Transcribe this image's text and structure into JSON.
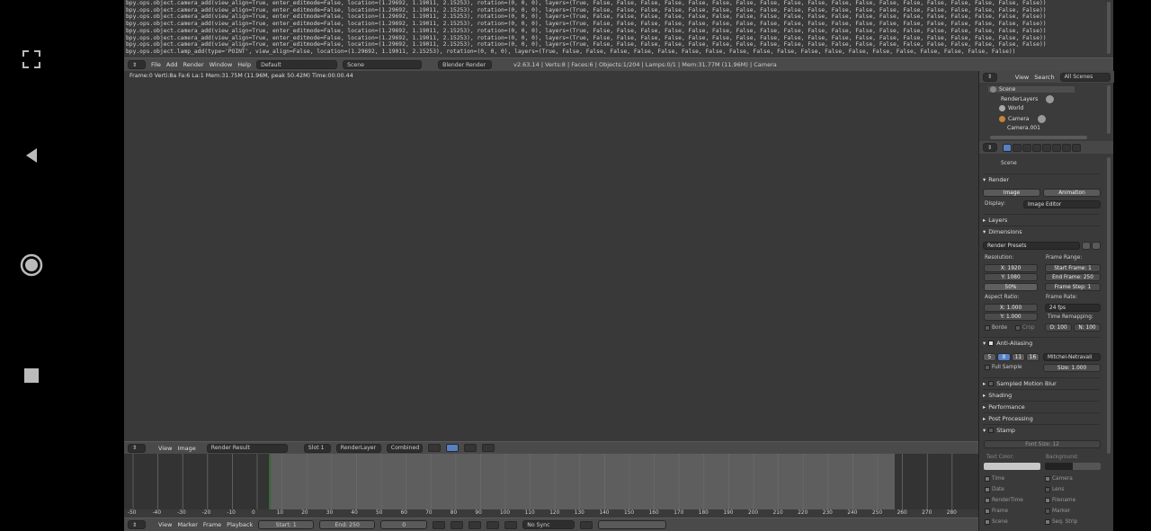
{
  "nav": {
    "expand_icon": "expand-icon",
    "back_icon": "back-icon",
    "home_icon": "home-icon",
    "recents_icon": "recents-icon"
  },
  "log_lines": [
    "bpy.ops.object.camera_add(view_align=True, enter_editmode=False, location=(1.29692, 1.19011, 2.15253), rotation=(0, 0, 0), layers=(True, False, False, False, False, False, False, False, False, False, False, False, False, False, False, False, False, False, False, False))",
    "bpy.ops.object.camera_add(view_align=True, enter_editmode=False, location=(1.29692, 1.19011, 2.15253), rotation=(0, 0, 0), layers=(True, False, False, False, False, False, False, False, False, False, False, False, False, False, False, False, False, False, False, False))",
    "bpy.ops.object.camera_add(view_align=True, enter_editmode=False, location=(1.29692, 1.19011, 2.15253), rotation=(0, 0, 0), layers=(True, False, False, False, False, False, False, False, False, False, False, False, False, False, False, False, False, False, False, False))",
    "bpy.ops.object.camera_add(view_align=True, enter_editmode=False, location=(1.29692, 1.19011, 2.15253), rotation=(0, 0, 0), layers=(True, False, False, False, False, False, False, False, False, False, False, False, False, False, False, False, False, False, False, False))",
    "bpy.ops.object.camera_add(view_align=True, enter_editmode=False, location=(1.29692, 1.19011, 2.15253), rotation=(0, 0, 0), layers=(True, False, False, False, False, False, False, False, False, False, False, False, False, False, False, False, False, False, False, False))",
    "bpy.ops.object.camera_add(view_align=True, enter_editmode=False, location=(1.29692, 1.19011, 2.15253), rotation=(0, 0, 0), layers=(True, False, False, False, False, False, False, False, False, False, False, False, False, False, False, False, False, False, False, False))",
    "bpy.ops.object.camera_add(view_align=True, enter_editmode=False, location=(1.29692, 1.19011, 2.15253), rotation=(0, 0, 0), layers=(True, False, False, False, False, False, False, False, False, False, False, False, False, False, False, False, False, False, False, False))",
    "bpy.ops.object.lamp_add(type='POINT', view_align=False, location=(1.29692, 1.19011, 2.15253), rotation=(0, 0, 0), layers=(True, False, False, False, False, False, False, False, False, False, False, False, False, False, False, False, False, False, False, False))"
  ],
  "topbar": {
    "menu": [
      "File",
      "Add",
      "Render",
      "Window",
      "Help"
    ],
    "layout": "Default",
    "scene": "Scene",
    "engine": "Blender Render",
    "stats": "v2.63.14 | Verts:8 | Faces:6 | Objects:1/204 | Lamps:0/1 | Mem:31.77M (11.96M) | Camera"
  },
  "viewport": {
    "info": "Frame:0 Verti:8a Fa:6 La:1 Mem:31.75M (11.96M, peak 50.42M) Time:00:00.44"
  },
  "image_header": {
    "view": "View",
    "image": "Image",
    "image_name": "Render Result",
    "slot": "Slot 1",
    "layer": "RenderLayer",
    "pass": "Combined"
  },
  "timeline": {
    "ticks": [
      "-50",
      "-40",
      "-30",
      "-20",
      "-10",
      "0",
      "10",
      "20",
      "30",
      "40",
      "50",
      "60",
      "70",
      "80",
      "90",
      "100",
      "110",
      "120",
      "130",
      "140",
      "150",
      "160",
      "170",
      "180",
      "190",
      "200",
      "210",
      "220",
      "230",
      "240",
      "250",
      "260",
      "270",
      "280"
    ]
  },
  "timeline_header": {
    "view": "View",
    "marker": "Marker",
    "frame": "Frame",
    "playback": "Playback",
    "start": "Start: 1",
    "end": "End: 250",
    "current": "0",
    "sync": "No Sync"
  },
  "outliner": {
    "view": "View",
    "search": "Search",
    "filter": "All Scenes",
    "items": [
      "Scene",
      "RenderLayers",
      "World",
      "Camera",
      "Camera.001"
    ]
  },
  "props": {
    "context": "Scene",
    "render": {
      "title": "Render",
      "image": "Image",
      "animation": "Animation",
      "display_label": "Display:",
      "display": "Image Editor"
    },
    "layers": "Layers",
    "dimensions": {
      "title": "Dimensions",
      "presets": "Render Presets",
      "res_label": "Resolution:",
      "x": "X: 1920",
      "y": "Y: 1080",
      "pct": "50%",
      "frame_label": "Frame Range:",
      "start": "Start Frame: 1",
      "end": "End Frame: 250",
      "step": "Frame Step: 1",
      "aspect_label": "Aspect Ratio:",
      "ax": "X: 1.000",
      "ay": "Y: 1.000",
      "fps_label": "Frame Rate:",
      "fps": "24 fps",
      "remap_label": "Time Remapping:",
      "old": "O: 100",
      "new": "N: 100",
      "border": "Borde",
      "crop": "Crop"
    },
    "aa": {
      "title": "Anti-Aliasing",
      "s5": "5",
      "s8": "8",
      "s11": "11",
      "s16": "16",
      "filter": "Mitchel-Netravali",
      "full": "Full Sample",
      "size": "Size: 1.000"
    },
    "sections": [
      "Sampled Motion Blur",
      "Shading",
      "Performance",
      "Post Processing"
    ],
    "stamp": {
      "title": "Stamp",
      "font": "Font Size: 12",
      "text_color": "Text Color:",
      "background": "Background:",
      "left": [
        "Time",
        "Date",
        "RenderTime",
        "Frame",
        "Scene"
      ],
      "right": [
        "Camera",
        "Lens",
        "Filename",
        "Marker",
        "Seq. Strip"
      ]
    }
  }
}
